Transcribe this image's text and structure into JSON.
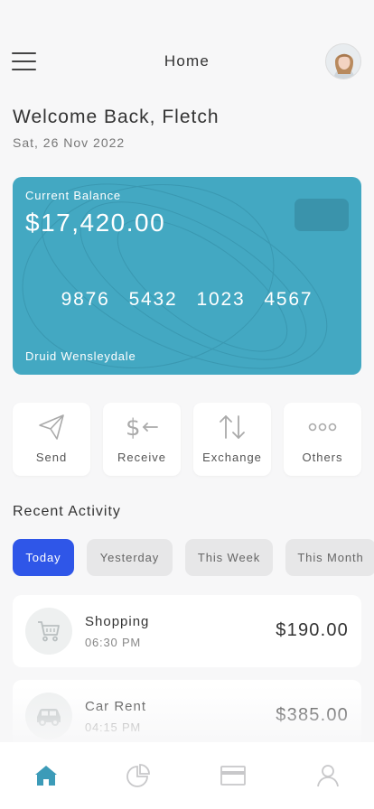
{
  "header": {
    "title": "Home",
    "menu_icon": "hamburger-menu-icon",
    "avatar": "user-avatar"
  },
  "welcome": {
    "greeting": "Welcome Back, Fletch",
    "date": "Sat, 26 Nov 2022"
  },
  "card": {
    "balance_label": "Current Balance",
    "balance": "$17,420.00",
    "number_groups": [
      "9876",
      "5432",
      "1023",
      "4567"
    ],
    "holder": "Druid Wensleydale",
    "color": "#43a8c2"
  },
  "actions": [
    {
      "label": "Send",
      "icon": "paper-plane-icon"
    },
    {
      "label": "Receive",
      "icon": "dollar-arrow-left-icon"
    },
    {
      "label": "Exchange",
      "icon": "up-down-arrows-icon"
    },
    {
      "label": "Others",
      "icon": "more-dots-icon"
    }
  ],
  "recent": {
    "title": "Recent Activity",
    "filters": [
      "Today",
      "Yesterday",
      "This Week",
      "This Month"
    ],
    "active_filter": "Today",
    "transactions": [
      {
        "name": "Shopping",
        "time": "06:30 PM",
        "amount": "$190.00",
        "icon": "shopping-cart-icon"
      },
      {
        "name": "Car Rent",
        "time": "04:15 PM",
        "amount": "$385.00",
        "icon": "car-icon"
      }
    ]
  },
  "tabbar": {
    "items": [
      "home-icon",
      "pie-chart-icon",
      "credit-card-icon",
      "profile-icon"
    ],
    "active": "home-icon",
    "accent": "#3c9bb8"
  },
  "colors": {
    "primary": "#2f56e8",
    "accent": "#43a8c2"
  }
}
